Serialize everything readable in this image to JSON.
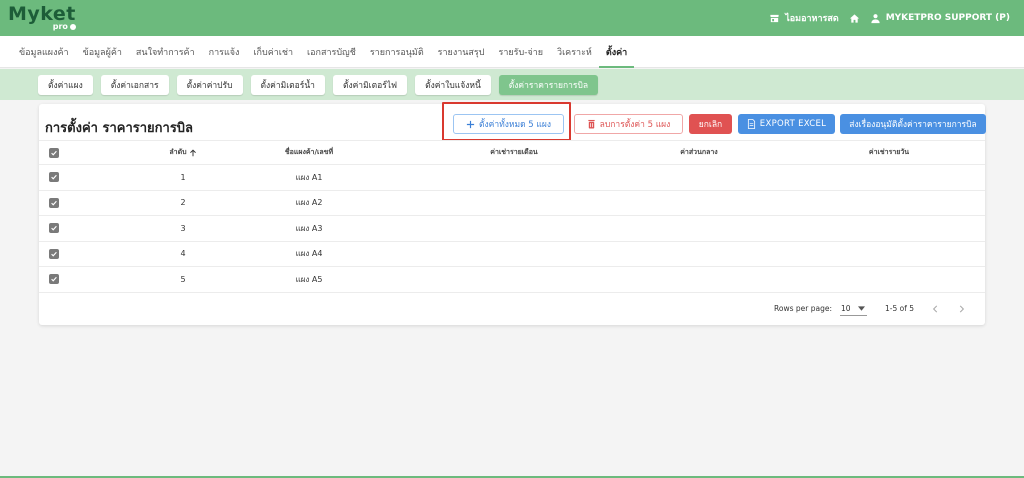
{
  "header": {
    "logo_main": "Myket",
    "logo_sub": "pro",
    "store_label": "ไอมอาหารสด",
    "user_label": "MYKETPRO SUPPORT (P)"
  },
  "nav": {
    "items": [
      {
        "label": "ข้อมูลแผงค้า"
      },
      {
        "label": "ข้อมูลผู้ค้า"
      },
      {
        "label": "สนใจทำการค้า"
      },
      {
        "label": "การแจ้ง"
      },
      {
        "label": "เก็บค่าเช่า"
      },
      {
        "label": "เอกสารบัญชี"
      },
      {
        "label": "รายการอนุมัติ"
      },
      {
        "label": "รายงานสรุป"
      },
      {
        "label": "รายรับ-จ่าย"
      },
      {
        "label": "วิเคราะห์"
      },
      {
        "label": "ตั้งค่า"
      }
    ],
    "active_index": 10
  },
  "subtabs": {
    "items": [
      {
        "label": "ตั้งค่าแผง"
      },
      {
        "label": "ตั้งค่าเอกสาร"
      },
      {
        "label": "ตั้งค่าค่าปรับ"
      },
      {
        "label": "ตั้งค่ามิเตอร์น้ำ"
      },
      {
        "label": "ตั้งค่ามิเตอร์ไฟ"
      },
      {
        "label": "ตั้งค่าใบแจ้งหนี้"
      },
      {
        "label": "ตั้งค่าราคารายการบิล"
      }
    ],
    "active_index": 6
  },
  "main": {
    "title": "การตั้งค่า ราคารายการบิล",
    "add_button": "ตั้งค่าทั้งหมด 5 แผง",
    "delete_button": "ลบการตั้งค่า 5 แผง",
    "cancel_button": "ยกเลิก",
    "export_button": "EXPORT EXCEL",
    "send_button": "ส่งเรื่องอนุมัติตั้งค่าราคารายการบิล"
  },
  "table": {
    "headers": [
      "ลำดับ",
      "ชื่อแผงค้า/เลขที่",
      "ค่าเช่ารายเดือน",
      "ค่าส่วนกลาง",
      "ค่าเช่ารายวัน"
    ],
    "sort_icon": "arrow-up-icon",
    "rows": [
      {
        "no": "1",
        "name": "แผง A1"
      },
      {
        "no": "2",
        "name": "แผง A2"
      },
      {
        "no": "3",
        "name": "แผง A3"
      },
      {
        "no": "4",
        "name": "แผง A4"
      },
      {
        "no": "5",
        "name": "แผง A5"
      }
    ]
  },
  "pagination": {
    "rows_per_page_label": "Rows per page:",
    "rows_per_page_value": "10",
    "range": "1-5 of 5"
  },
  "colors": {
    "brand_green": "#6cba7d",
    "subbar_green": "#cfe9d2",
    "blue": "#4a90e2",
    "red": "#e05252",
    "highlight": "#d9392f"
  }
}
